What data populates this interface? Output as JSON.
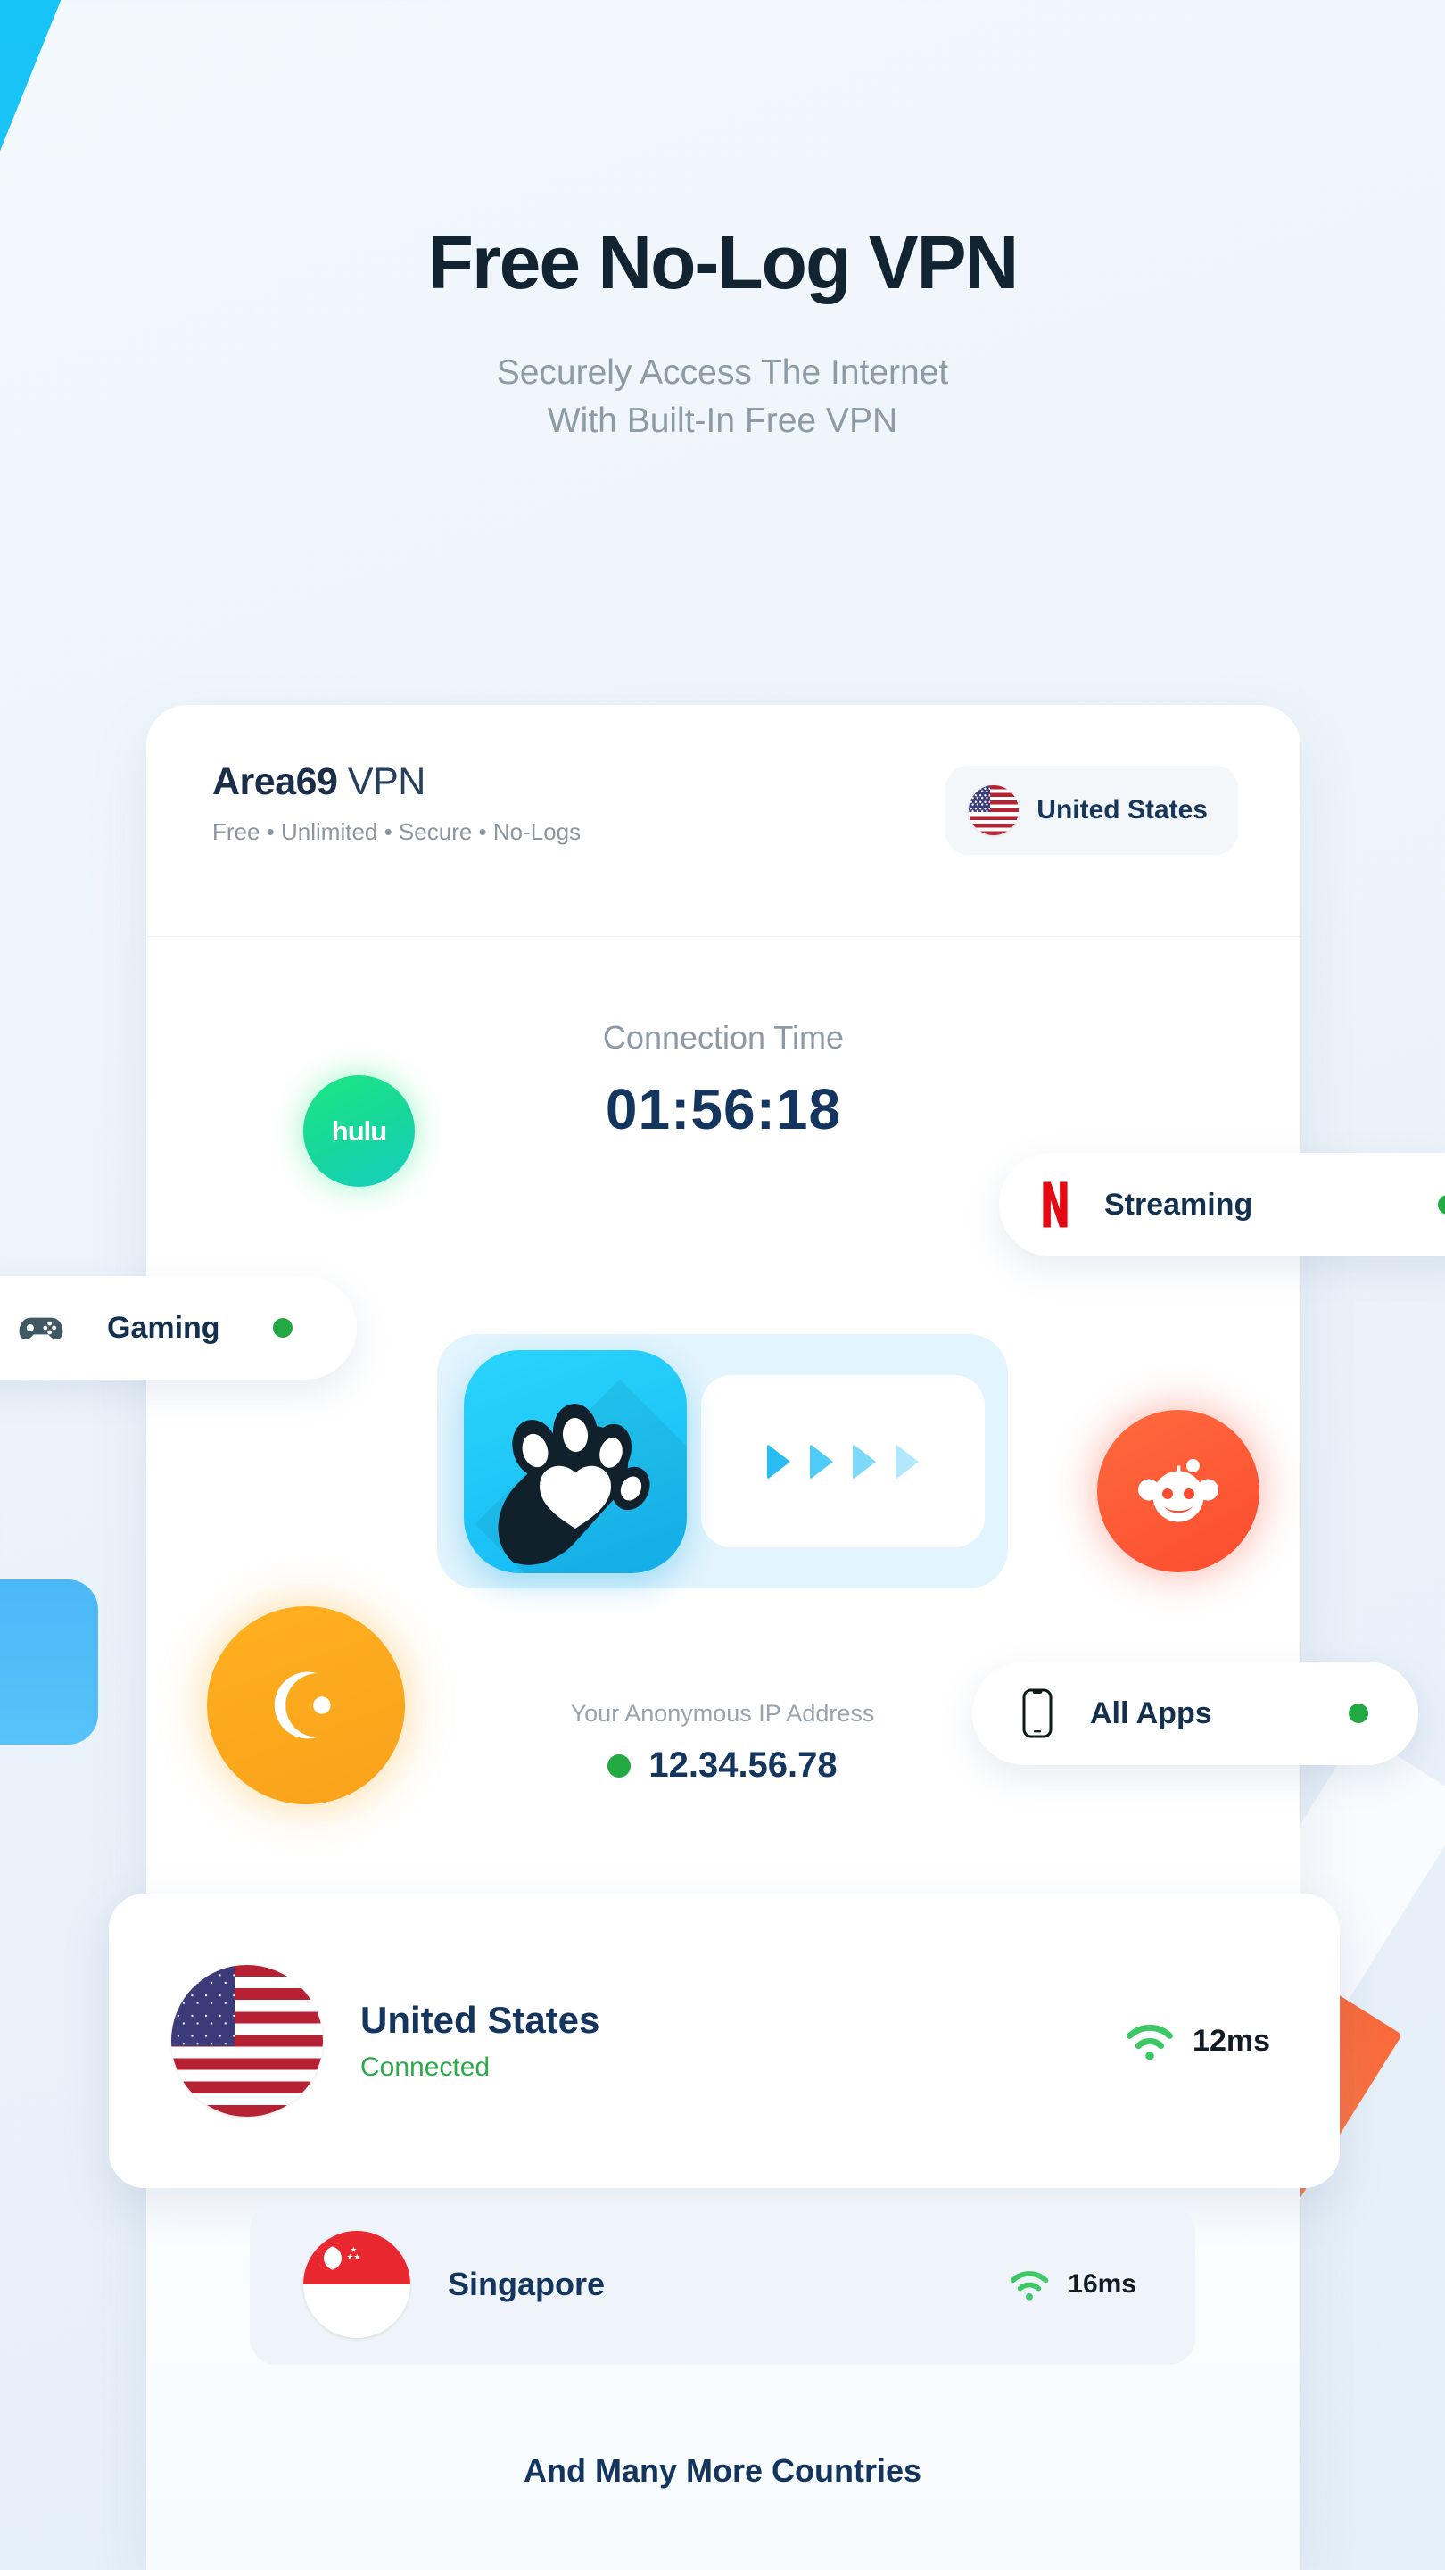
{
  "hero": {
    "title": "Free No-Log VPN",
    "subtitle_line1": "Securely Access The Internet",
    "subtitle_line2": "With Built-In Free VPN"
  },
  "card": {
    "brand_name": "Area69",
    "brand_suffix": "VPN",
    "brand_tagline": "Free • Unlimited • Secure • No-Logs",
    "country_pill_label": "United States"
  },
  "connection": {
    "label": "Connection Time",
    "time": "01:56:18"
  },
  "ip": {
    "label": "Your Anonymous IP Address",
    "value": "12.34.56.78"
  },
  "badges": {
    "hulu": "hulu",
    "reddit_icon": "reddit-icon",
    "crunchyroll_icon": "crunchyroll-icon"
  },
  "pills": [
    {
      "label": "Streaming",
      "icon": "netflix-icon",
      "status": "online"
    },
    {
      "label": "Gaming",
      "icon": "gamepad-icon",
      "status": "online"
    },
    {
      "label": "All Apps",
      "icon": "phone-icon",
      "status": "online"
    }
  ],
  "servers": [
    {
      "name": "United States",
      "status": "Connected",
      "ping": "12ms",
      "flag": "us-flag"
    },
    {
      "name": "Singapore",
      "ping": "16ms",
      "flag": "sg-flag"
    }
  ],
  "footer": {
    "note": "And Many More Countries"
  },
  "colors": {
    "accent_cyan": "#15b8f5",
    "navy": "#14355e",
    "green": "#23a942",
    "orange": "#f9a21b",
    "red": "#fb4c2f",
    "netflix_red": "#e50914"
  }
}
